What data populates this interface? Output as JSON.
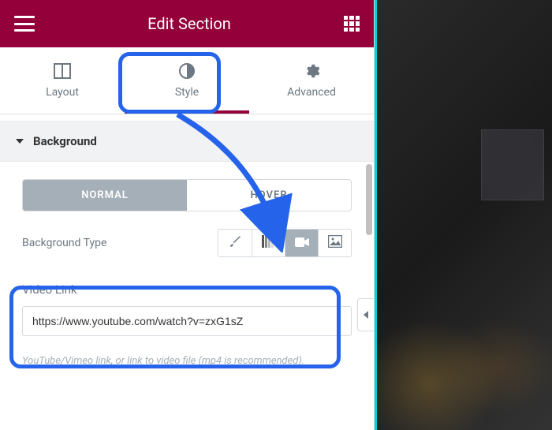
{
  "header": {
    "title": "Edit Section"
  },
  "tabs": {
    "layout": {
      "label": "Layout"
    },
    "style": {
      "label": "Style"
    },
    "advanced": {
      "label": "Advanced"
    }
  },
  "section": {
    "title": "Background"
  },
  "states": {
    "normal": "NORMAL",
    "hover": "HOVER"
  },
  "bg_type": {
    "label": "Background Type"
  },
  "video_link": {
    "label": "Video Link",
    "value": "https://www.youtube.com/watch?v=zxG1sZ",
    "helper": "YouTube/Vimeo link, or link to video file (mp4 is recommended)."
  },
  "colors": {
    "brand": "#93003a",
    "highlight": "#2563eb"
  }
}
